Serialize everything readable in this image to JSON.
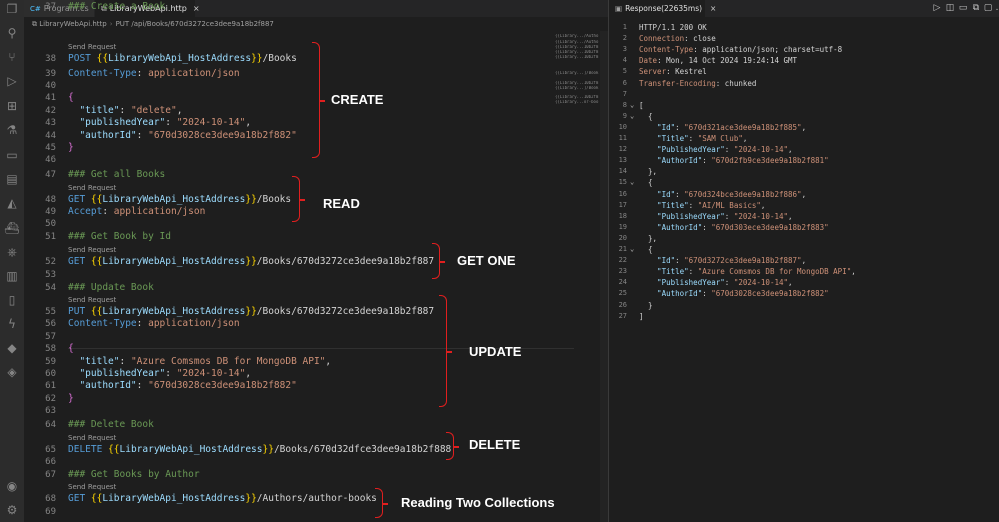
{
  "tabs": [
    {
      "label": "Program.cs",
      "icon": "csharp-icon",
      "badge": "C#"
    },
    {
      "label": "LibraryWebApi.http",
      "icon": "http-file-icon",
      "active": true
    }
  ],
  "breadcrumb": [
    "LibraryWebApi.http",
    "PUT /api/Books/670d3272ce3dee9a18b2f887"
  ],
  "codelens": "Send Request",
  "editor_lines": [
    {
      "n": "37",
      "spans": [
        [
          "c-comment",
          "### Create a Book"
        ]
      ]
    },
    {
      "n": "38",
      "lens": true,
      "spans": [
        [
          "c-method",
          "POST "
        ],
        [
          "c-brace",
          "{{"
        ],
        [
          "c-var",
          "LibraryWebApi_HostAddress"
        ],
        [
          "c-brace",
          "}}"
        ],
        [
          "c-url",
          "/Books"
        ]
      ]
    },
    {
      "n": "39",
      "spans": [
        [
          "c-hkey",
          "Content-Type"
        ],
        [
          "c-punct",
          ": "
        ],
        [
          "c-hval",
          "application/json"
        ]
      ]
    },
    {
      "n": "40",
      "spans": []
    },
    {
      "n": "41",
      "spans": [
        [
          "c-jbrace",
          "{"
        ]
      ]
    },
    {
      "n": "42",
      "spans": [
        [
          "c-jkey",
          "  \"title\""
        ],
        [
          "c-punct",
          ": "
        ],
        [
          "c-jstr",
          "\"delete\""
        ],
        [
          "c-punct",
          ","
        ]
      ]
    },
    {
      "n": "43",
      "spans": [
        [
          "c-jkey",
          "  \"publishedYear\""
        ],
        [
          "c-punct",
          ": "
        ],
        [
          "c-jstr",
          "\"2024-10-14\""
        ],
        [
          "c-punct",
          ","
        ]
      ]
    },
    {
      "n": "44",
      "spans": [
        [
          "c-jkey",
          "  \"authorId\""
        ],
        [
          "c-punct",
          ": "
        ],
        [
          "c-jstr",
          "\"670d3028ce3dee9a18b2f882\""
        ]
      ]
    },
    {
      "n": "45",
      "spans": [
        [
          "c-jbrace",
          "}"
        ]
      ]
    },
    {
      "n": "46",
      "spans": []
    },
    {
      "n": "47",
      "spans": [
        [
          "c-comment",
          "### Get all Books"
        ]
      ]
    },
    {
      "n": "48",
      "lens": true,
      "spans": [
        [
          "c-method",
          "GET "
        ],
        [
          "c-brace",
          "{{"
        ],
        [
          "c-var",
          "LibraryWebApi_HostAddress"
        ],
        [
          "c-brace",
          "}}"
        ],
        [
          "c-url",
          "/Books"
        ]
      ]
    },
    {
      "n": "49",
      "spans": [
        [
          "c-hkey",
          "Accept"
        ],
        [
          "c-punct",
          ": "
        ],
        [
          "c-hval",
          "application/json"
        ]
      ]
    },
    {
      "n": "50",
      "spans": []
    },
    {
      "n": "51",
      "spans": [
        [
          "c-comment",
          "### Get Book by Id"
        ]
      ]
    },
    {
      "n": "52",
      "lens": true,
      "spans": [
        [
          "c-method",
          "GET "
        ],
        [
          "c-brace",
          "{{"
        ],
        [
          "c-var",
          "LibraryWebApi_HostAddress"
        ],
        [
          "c-brace",
          "}}"
        ],
        [
          "c-url",
          "/Books/670d3272ce3dee9a18b2f887"
        ]
      ]
    },
    {
      "n": "53",
      "spans": []
    },
    {
      "n": "54",
      "spans": [
        [
          "c-comment",
          "### Update Book"
        ]
      ]
    },
    {
      "n": "55",
      "lens": true,
      "spans": [
        [
          "c-method",
          "PUT "
        ],
        [
          "c-brace",
          "{{"
        ],
        [
          "c-var",
          "LibraryWebApi_HostAddress"
        ],
        [
          "c-brace",
          "}}"
        ],
        [
          "c-url",
          "/Books/670d3272ce3dee9a18b2f887"
        ]
      ]
    },
    {
      "n": "56",
      "spans": [
        [
          "c-hkey",
          "Content-Type"
        ],
        [
          "c-punct",
          ": "
        ],
        [
          "c-hval",
          "application/json"
        ]
      ]
    },
    {
      "n": "57",
      "spans": []
    },
    {
      "n": "58",
      "spans": [
        [
          "c-jbrace",
          "{"
        ]
      ]
    },
    {
      "n": "59",
      "spans": [
        [
          "c-jkey",
          "  \"title\""
        ],
        [
          "c-punct",
          ": "
        ],
        [
          "c-jstr",
          "\"Azure Comsmos DB for MongoDB API\""
        ],
        [
          "c-punct",
          ","
        ]
      ]
    },
    {
      "n": "60",
      "spans": [
        [
          "c-jkey",
          "  \"publishedYear\""
        ],
        [
          "c-punct",
          ": "
        ],
        [
          "c-jstr",
          "\"2024-10-14\""
        ],
        [
          "c-punct",
          ","
        ]
      ]
    },
    {
      "n": "61",
      "spans": [
        [
          "c-jkey",
          "  \"authorId\""
        ],
        [
          "c-punct",
          ": "
        ],
        [
          "c-jstr",
          "\"670d3028ce3dee9a18b2f882\""
        ]
      ]
    },
    {
      "n": "62",
      "spans": [
        [
          "c-jbrace",
          "}"
        ]
      ]
    },
    {
      "n": "63",
      "spans": []
    },
    {
      "n": "64",
      "spans": [
        [
          "c-comment",
          "### Delete Book"
        ]
      ]
    },
    {
      "n": "65",
      "lens": true,
      "spans": [
        [
          "c-method",
          "DELETE "
        ],
        [
          "c-brace",
          "{{"
        ],
        [
          "c-var",
          "LibraryWebApi_HostAddress"
        ],
        [
          "c-brace",
          "}}"
        ],
        [
          "c-url",
          "/Books/670d32dfce3dee9a18b2f888"
        ]
      ]
    },
    {
      "n": "66",
      "spans": []
    },
    {
      "n": "67",
      "spans": [
        [
          "c-comment",
          "### Get Books by Author"
        ]
      ]
    },
    {
      "n": "68",
      "lens": true,
      "spans": [
        [
          "c-method",
          "GET "
        ],
        [
          "c-brace",
          "{{"
        ],
        [
          "c-var",
          "LibraryWebApi_HostAddress"
        ],
        [
          "c-brace",
          "}}"
        ],
        [
          "c-url",
          "/Authors/author-books"
        ]
      ]
    },
    {
      "n": "69",
      "spans": []
    }
  ],
  "minimap_lines": [
    "{{Library.../Autho",
    "{{Library.../Autho",
    "{{Library...10b2f8",
    "{{Library...10b2f8",
    "{{Library...10b2f8",
    "{{Library...]/Book",
    "{{Library...10b2f8",
    "{{Library...]/Book",
    "{{Library...10b2f8",
    "{{Library...or-boo"
  ],
  "annotations": {
    "create": "CREATE",
    "read": "READ",
    "get_one": "GET ONE",
    "update": "UPDATE",
    "delete": "DELETE",
    "reading_two": "Reading Two Collections"
  },
  "response_tab": {
    "label": "Response(22635ms)"
  },
  "response_lines": [
    {
      "n": "1",
      "spans": [
        [
          "r-status",
          "HTTP/1.1 200 OK"
        ]
      ]
    },
    {
      "n": "2",
      "spans": [
        [
          "r-hkey",
          "Connection"
        ],
        [
          "r-hval",
          ": close"
        ]
      ]
    },
    {
      "n": "3",
      "spans": [
        [
          "r-hkey",
          "Content-Type"
        ],
        [
          "r-hval",
          ": application/json; charset=utf-8"
        ]
      ]
    },
    {
      "n": "4",
      "spans": [
        [
          "r-hkey",
          "Date"
        ],
        [
          "r-hval",
          ": Mon, 14 Oct 2024 19:24:14 GMT"
        ]
      ]
    },
    {
      "n": "5",
      "spans": [
        [
          "r-hkey",
          "Server"
        ],
        [
          "r-hval",
          ": Kestrel"
        ]
      ]
    },
    {
      "n": "6",
      "spans": [
        [
          "r-hkey",
          "Transfer-Encoding"
        ],
        [
          "r-hval",
          ": chunked"
        ]
      ]
    },
    {
      "n": "7",
      "spans": []
    },
    {
      "n": "8",
      "fold": "⌄",
      "spans": [
        [
          "r-br",
          "["
        ]
      ]
    },
    {
      "n": "9",
      "fold": "⌄",
      "spans": [
        [
          "r-br",
          "  {"
        ]
      ]
    },
    {
      "n": "10",
      "spans": [
        [
          "r-key",
          "    \"Id\""
        ],
        [
          "r-p",
          ": "
        ],
        [
          "r-str",
          "\"670d321ace3dee9a18b2f885\""
        ],
        [
          "r-p",
          ","
        ]
      ]
    },
    {
      "n": "11",
      "spans": [
        [
          "r-key",
          "    \"Title\""
        ],
        [
          "r-p",
          ": "
        ],
        [
          "r-str",
          "\"SAM Club\""
        ],
        [
          "r-p",
          ","
        ]
      ]
    },
    {
      "n": "12",
      "spans": [
        [
          "r-key",
          "    \"PublishedYear\""
        ],
        [
          "r-p",
          ": "
        ],
        [
          "r-str",
          "\"2024-10-14\""
        ],
        [
          "r-p",
          ","
        ]
      ]
    },
    {
      "n": "13",
      "spans": [
        [
          "r-key",
          "    \"AuthorId\""
        ],
        [
          "r-p",
          ": "
        ],
        [
          "r-str",
          "\"670d2fb9ce3dee9a18b2f881\""
        ]
      ]
    },
    {
      "n": "14",
      "spans": [
        [
          "r-br",
          "  },"
        ]
      ]
    },
    {
      "n": "15",
      "fold": "⌄",
      "spans": [
        [
          "r-br",
          "  {"
        ]
      ]
    },
    {
      "n": "16",
      "spans": [
        [
          "r-key",
          "    \"Id\""
        ],
        [
          "r-p",
          ": "
        ],
        [
          "r-str",
          "\"670d324bce3dee9a18b2f886\""
        ],
        [
          "r-p",
          ","
        ]
      ]
    },
    {
      "n": "17",
      "spans": [
        [
          "r-key",
          "    \"Title\""
        ],
        [
          "r-p",
          ": "
        ],
        [
          "r-str",
          "\"AI/ML Basics\""
        ],
        [
          "r-p",
          ","
        ]
      ]
    },
    {
      "n": "18",
      "spans": [
        [
          "r-key",
          "    \"PublishedYear\""
        ],
        [
          "r-p",
          ": "
        ],
        [
          "r-str",
          "\"2024-10-14\""
        ],
        [
          "r-p",
          ","
        ]
      ]
    },
    {
      "n": "19",
      "spans": [
        [
          "r-key",
          "    \"AuthorId\""
        ],
        [
          "r-p",
          ": "
        ],
        [
          "r-str",
          "\"670d303ece3dee9a18b2f883\""
        ]
      ]
    },
    {
      "n": "20",
      "spans": [
        [
          "r-br",
          "  },"
        ]
      ]
    },
    {
      "n": "21",
      "fold": "⌄",
      "spans": [
        [
          "r-br",
          "  {"
        ]
      ]
    },
    {
      "n": "22",
      "spans": [
        [
          "r-key",
          "    \"Id\""
        ],
        [
          "r-p",
          ": "
        ],
        [
          "r-str",
          "\"670d3272ce3dee9a18b2f887\""
        ],
        [
          "r-p",
          ","
        ]
      ]
    },
    {
      "n": "23",
      "spans": [
        [
          "r-key",
          "    \"Title\""
        ],
        [
          "r-p",
          ": "
        ],
        [
          "r-str",
          "\"Azure Comsmos DB for MongoDB API\""
        ],
        [
          "r-p",
          ","
        ]
      ]
    },
    {
      "n": "24",
      "spans": [
        [
          "r-key",
          "    \"PublishedYear\""
        ],
        [
          "r-p",
          ": "
        ],
        [
          "r-str",
          "\"2024-10-14\""
        ],
        [
          "r-p",
          ","
        ]
      ]
    },
    {
      "n": "25",
      "spans": [
        [
          "r-key",
          "    \"AuthorId\""
        ],
        [
          "r-p",
          ": "
        ],
        [
          "r-str",
          "\"670d3028ce3dee9a18b2f882\""
        ]
      ]
    },
    {
      "n": "26",
      "spans": [
        [
          "r-br",
          "  }"
        ]
      ]
    },
    {
      "n": "27",
      "spans": [
        [
          "r-br",
          "]"
        ]
      ]
    }
  ],
  "activity_icons": [
    "files-icon",
    "search-icon",
    "source-control-icon",
    "run-debug-icon",
    "extensions-icon",
    "testing-icon",
    "remote-explorer-icon",
    "folder-icon",
    "azure-icon",
    "docker-icon",
    "kubernetes-icon",
    "database-icon",
    "notebook-icon",
    "lightning-icon",
    "mongodb-icon",
    "copilot-icon",
    "account-icon",
    "settings-gear-icon"
  ],
  "response_toolbar_icons": [
    "run-icon",
    "split-editor-icon",
    "save-icon",
    "copy-icon",
    "open-preview-icon",
    "more-actions-icon"
  ],
  "colors": {
    "annotation_red": "#e01f1f",
    "editor_bg": "#1e1e1e",
    "activity_bg": "#2c2c2c"
  }
}
